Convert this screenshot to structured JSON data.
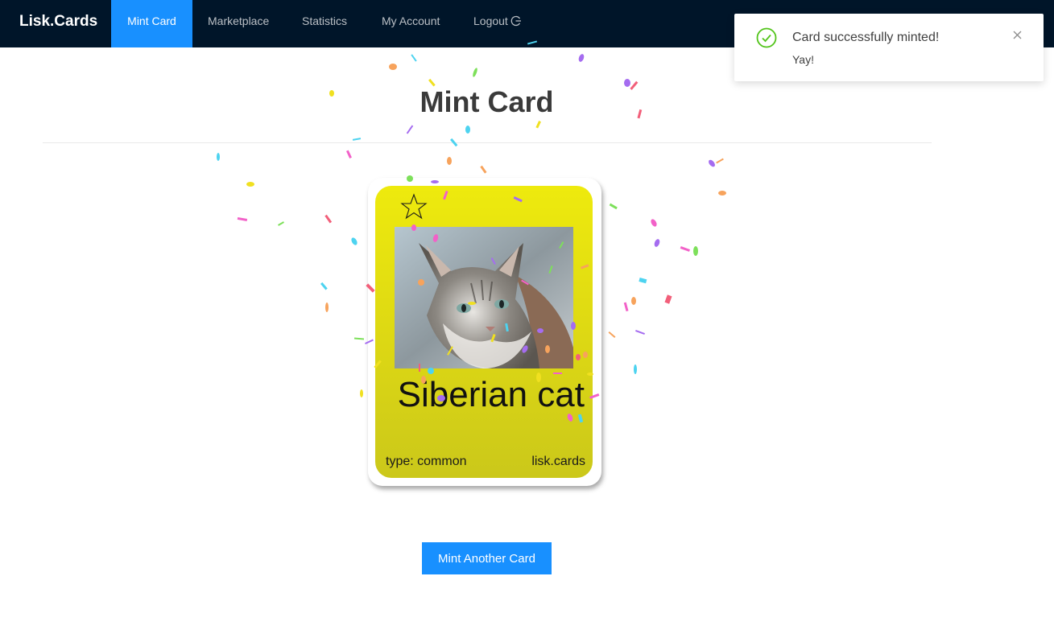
{
  "nav": {
    "brand": "Lisk.Cards",
    "items": [
      {
        "label": "Mint Card"
      },
      {
        "label": "Marketplace"
      },
      {
        "label": "Statistics"
      },
      {
        "label": "My Account"
      },
      {
        "label": "Logout"
      }
    ],
    "active_color": "#1890ff",
    "background": "#001529"
  },
  "page": {
    "title": "Mint Card"
  },
  "card": {
    "name": "Siberian cat",
    "type_label": "type: common",
    "site": "lisk.cards",
    "star_icon": "star-outline-icon",
    "color": "#eeea0d"
  },
  "actions": {
    "mint_another": "Mint Another Card"
  },
  "notification": {
    "title": "Card successfully minted!",
    "description": "Yay!",
    "icon": "check-circle-icon",
    "close_icon": "close-icon",
    "status_color": "#52c41a"
  }
}
